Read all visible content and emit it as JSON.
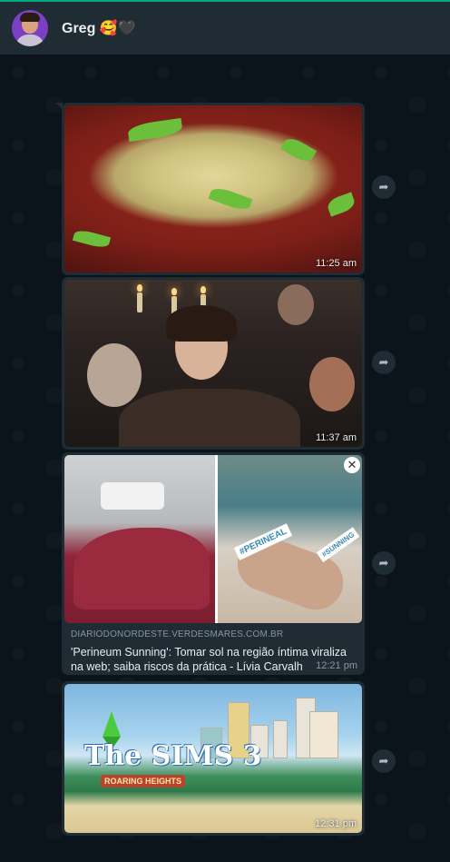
{
  "header": {
    "contact_name": "Greg 🥰🖤"
  },
  "messages": [
    {
      "kind": "image",
      "subject": "salad",
      "time": "11:25 am"
    },
    {
      "kind": "image",
      "subject": "scene",
      "time": "11:37 am"
    },
    {
      "kind": "link_preview",
      "site": "DIARIODONORDESTE.VERDESMARES.COM.BR",
      "title": "'Perineum Sunning': Tomar sol na região íntima viraliza na web; saiba riscos da prática - Lívia Carvalh",
      "tags": [
        "#PERINEAL",
        "#SUNNING"
      ],
      "time": "12:21 pm"
    },
    {
      "kind": "image",
      "subject": "sims",
      "logo": "The SIMS 3",
      "logo_sub": "ROARING HEIGHTS",
      "time": "12:31 pm"
    }
  ],
  "icons": {
    "forward": "forward-icon",
    "close": "close-icon"
  },
  "colors": {
    "accent": "#00a884",
    "header_bg": "#202c33",
    "chat_bg": "#0b141a",
    "bubble_bg": "#1f2c33"
  }
}
